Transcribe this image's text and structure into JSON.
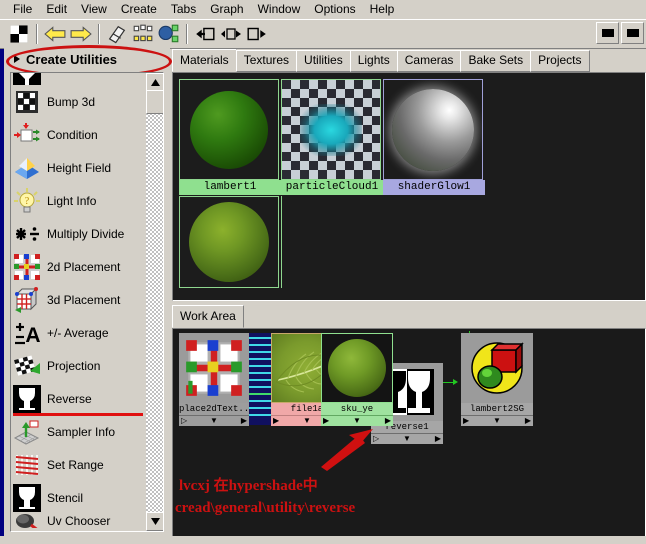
{
  "menu": {
    "items": [
      "File",
      "Edit",
      "View",
      "Create",
      "Tabs",
      "Graph",
      "Window",
      "Options",
      "Help"
    ]
  },
  "toolbar": {
    "buttons": [
      {
        "name": "checker-swatch-icon",
        "label": ""
      },
      {
        "name": "back-arrow-icon",
        "label": ""
      },
      {
        "name": "forward-arrow-icon",
        "label": ""
      },
      {
        "name": "eraser-icon",
        "label": ""
      },
      {
        "name": "graph-nodes-icon",
        "label": ""
      },
      {
        "name": "network-icon",
        "label": ""
      },
      {
        "name": "input-connections-icon",
        "label": ""
      },
      {
        "name": "input-output-connections-icon",
        "label": ""
      },
      {
        "name": "output-connections-icon",
        "label": ""
      }
    ],
    "window_buttons": [
      "minimize",
      "maximize"
    ]
  },
  "sidebar": {
    "title": "Create Utilities",
    "items": [
      {
        "label": "Bump 3d",
        "icon": "bump3d-icon"
      },
      {
        "label": "Condition",
        "icon": "condition-icon"
      },
      {
        "label": "Height Field",
        "icon": "heightfield-icon"
      },
      {
        "label": "Light Info",
        "icon": "lightinfo-icon"
      },
      {
        "label": "Multiply Divide",
        "icon": "multiplydivide-icon"
      },
      {
        "label": "2d Placement",
        "icon": "placement2d-icon"
      },
      {
        "label": "3d Placement",
        "icon": "placement3d-icon"
      },
      {
        "label": "+/- Average",
        "icon": "plusminusaverage-icon"
      },
      {
        "label": "Projection",
        "icon": "projection-icon"
      },
      {
        "label": "Reverse",
        "icon": "reverse-icon"
      },
      {
        "label": "Sampler Info",
        "icon": "samplerinfo-icon"
      },
      {
        "label": "Set Range",
        "icon": "setrange-icon"
      },
      {
        "label": "Stencil",
        "icon": "stencil-icon"
      },
      {
        "label": "Uv Chooser",
        "icon": "uvchooser-icon"
      }
    ],
    "highlight_color": "#e01010",
    "annotation_ellipse_color": "#cc1111"
  },
  "tabs": {
    "items": [
      "Materials",
      "Textures",
      "Utilities",
      "Lights",
      "Cameras",
      "Bake Sets",
      "Projects"
    ],
    "active": "Materials"
  },
  "swatches": [
    {
      "name": "lambert1",
      "type": "lambert-ball"
    },
    {
      "name": "particleCloud1",
      "type": "checker-cloud"
    },
    {
      "name": "shaderGlow1",
      "type": "chrome-ball"
    },
    {
      "name": "",
      "type": "green-ball"
    }
  ],
  "work_area": {
    "tabs": [
      "Work Area"
    ],
    "active": "Work Area",
    "nodes": [
      {
        "id": "place2dTexture",
        "label": "place2dText...",
        "title_color": "#9d9d9d"
      },
      {
        "id": "file1",
        "label": "file1a",
        "title_color": "#f0a8a8"
      },
      {
        "id": "reverse1",
        "label": "reverse1",
        "title_color": "#a0a0a0"
      },
      {
        "id": "skin_ye",
        "label": "sku_ye",
        "title_color": "#9fe29f"
      },
      {
        "id": "lambert2SG",
        "label": "lambert2SG",
        "title_color": "#a0a0a0"
      }
    ],
    "connection_color": "#22c822"
  },
  "annotation": {
    "line1": "lvcxj 在hypershade中",
    "line2": "cread\\general\\utility\\reverse",
    "color": "#cc1111",
    "arrow": "red-arrow-pointing-to-reverse-node"
  }
}
